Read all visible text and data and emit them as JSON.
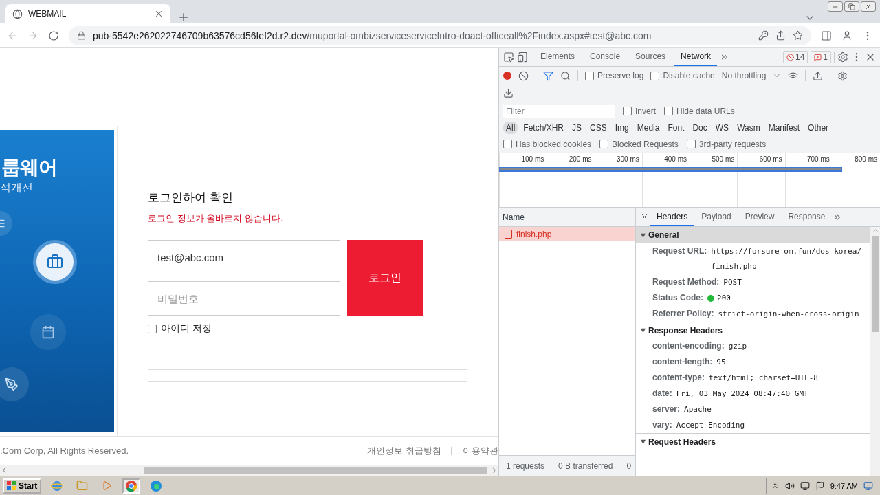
{
  "browser": {
    "tab": {
      "title": "WEBMAIL"
    },
    "address": {
      "host": "pub-5542e262022746709b63576cd56fef2d.r2.dev",
      "path": "/muportal-ombizserviceserviceIntro-doact-officeall%2Findex.aspx#test@abc.com"
    }
  },
  "page": {
    "banner": {
      "title": "룹웨어",
      "subtitle": "적개선"
    },
    "login": {
      "heading": "로그인하여 확인",
      "error": "로그인 정보가 올바르지 않습니다.",
      "email": {
        "value": "test@abc.com"
      },
      "password": {
        "placeholder": "비밀번호"
      },
      "submit": "로그인",
      "remember": {
        "label": "아이디 저장",
        "checked": false
      }
    },
    "footer": {
      "copyright": ".Com Corp, All Rights Reserved.",
      "links": [
        "개인정보 취급방침",
        "이용약관"
      ],
      "separator": "|"
    }
  },
  "devtools": {
    "tabs": [
      {
        "label": "Elements",
        "selected": false
      },
      {
        "label": "Console",
        "selected": false
      },
      {
        "label": "Sources",
        "selected": false
      },
      {
        "label": "Network",
        "selected": true
      }
    ],
    "errors": "14",
    "issues": "1",
    "toolbar": {
      "recording": true,
      "options": [
        {
          "label": "Preserve log",
          "checked": false
        },
        {
          "label": "Disable cache",
          "checked": false
        }
      ],
      "throttling": "No throttling"
    },
    "filter": {
      "placeholder": "Filter",
      "options": [
        {
          "label": "Invert",
          "checked": false
        },
        {
          "label": "Hide data URLs",
          "checked": false
        }
      ]
    },
    "types": [
      {
        "label": "All",
        "selected": true
      },
      {
        "label": "Fetch/XHR",
        "selected": false
      },
      {
        "label": "JS",
        "selected": false
      },
      {
        "label": "CSS",
        "selected": false
      },
      {
        "label": "Img",
        "selected": false
      },
      {
        "label": "Media",
        "selected": false
      },
      {
        "label": "Font",
        "selected": false
      },
      {
        "label": "Doc",
        "selected": false
      },
      {
        "label": "WS",
        "selected": false
      },
      {
        "label": "Wasm",
        "selected": false
      },
      {
        "label": "Manifest",
        "selected": false
      },
      {
        "label": "Other",
        "selected": false
      }
    ],
    "blocked": [
      {
        "label": "Has blocked cookies",
        "checked": false
      },
      {
        "label": "Blocked Requests",
        "checked": false
      },
      {
        "label": "3rd-party requests",
        "checked": false
      }
    ],
    "timeline": {
      "ticks": [
        "100 ms",
        "200 ms",
        "300 ms",
        "400 ms",
        "500 ms",
        "600 ms",
        "700 ms",
        "800 ms"
      ]
    },
    "requests": {
      "column": "Name",
      "rows": [
        {
          "name": "finish.php",
          "selected": true,
          "failed": true
        }
      ],
      "summary": [
        "1 requests",
        "0 B transferred",
        "0"
      ]
    },
    "details": {
      "tabs": [
        {
          "label": "Headers",
          "selected": true
        },
        {
          "label": "Payload",
          "selected": false
        },
        {
          "label": "Preview",
          "selected": false
        },
        {
          "label": "Response",
          "selected": false
        }
      ],
      "sections": [
        {
          "title": "General",
          "expanded": true,
          "highlighted": true,
          "entries": [
            {
              "key": "Request URL:",
              "value": "https://forsure-om.fun/dos-korea/finish.php"
            },
            {
              "key": "Request Method:",
              "value": "POST"
            },
            {
              "key": "Status Code:",
              "value": "200",
              "kind": "status",
              "color": "#22b83a"
            },
            {
              "key": "Referrer Policy:",
              "value": "strict-origin-when-cross-origin"
            }
          ]
        },
        {
          "title": "Response Headers",
          "expanded": true,
          "highlighted": false,
          "entries": [
            {
              "key": "content-encoding:",
              "value": "gzip"
            },
            {
              "key": "content-length:",
              "value": "95"
            },
            {
              "key": "content-type:",
              "value": "text/html; charset=UTF-8"
            },
            {
              "key": "date:",
              "value": "Fri, 03 May 2024 08:47:40 GMT"
            },
            {
              "key": "server:",
              "value": "Apache"
            },
            {
              "key": "vary:",
              "value": "Accept-Encoding"
            }
          ]
        },
        {
          "title": "Request Headers",
          "expanded": true,
          "highlighted": false
        }
      ]
    }
  },
  "taskbar": {
    "start": "Start",
    "clock": "9:47 AM"
  }
}
